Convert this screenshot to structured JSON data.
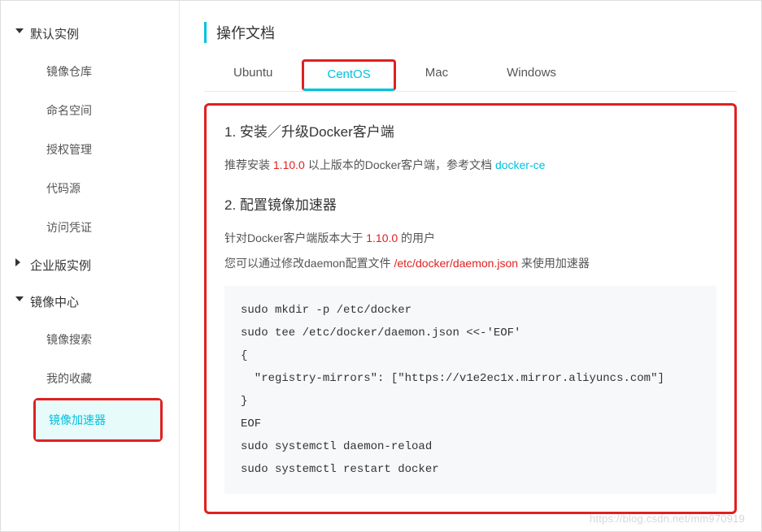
{
  "sidebar": {
    "groups": [
      {
        "label": "默认实例",
        "expanded": true,
        "items": [
          "镜像仓库",
          "命名空间",
          "授权管理",
          "代码源",
          "访问凭证"
        ]
      },
      {
        "label": "企业版实例",
        "expanded": false,
        "items": []
      },
      {
        "label": "镜像中心",
        "expanded": true,
        "items": [
          "镜像搜索",
          "我的收藏",
          "镜像加速器"
        ],
        "active": 2
      }
    ]
  },
  "main": {
    "title": "操作文档",
    "tabs": [
      "Ubuntu",
      "CentOS",
      "Mac",
      "Windows"
    ],
    "active_tab": 1,
    "section1_title": "1. 安装／升级Docker客户端",
    "install_prefix": "推荐安装 ",
    "install_version": "1.10.0",
    "install_suffix": " 以上版本的Docker客户端，参考文档 ",
    "install_link": "docker-ce",
    "section2_title": "2. 配置镜像加速器",
    "config_line1_prefix": "针对Docker客户端版本大于 ",
    "config_line1_version": "1.10.0",
    "config_line1_suffix": " 的用户",
    "config_line2_prefix": "您可以通过修改daemon配置文件 ",
    "config_path": "/etc/docker/daemon.json",
    "config_line2_suffix": " 来使用加速器",
    "code": "sudo mkdir -p /etc/docker\nsudo tee /etc/docker/daemon.json <<-'EOF'\n{\n  \"registry-mirrors\": [\"https://v1e2ec1x.mirror.aliyuncs.com\"]\n}\nEOF\nsudo systemctl daemon-reload\nsudo systemctl restart docker"
  },
  "watermark": "https://blog.csdn.net/mm970919"
}
